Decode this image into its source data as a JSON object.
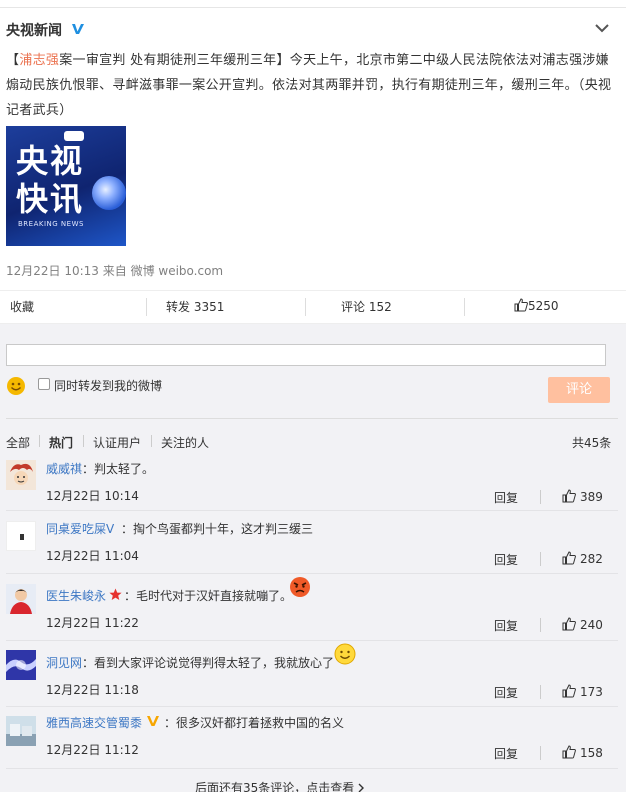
{
  "post": {
    "author": "央视新闻",
    "text_highlight": "浦志强",
    "text_topic": "案一审宣判 处有期徒刑三年缓刑三年",
    "text_body": "今天上午，北京市第二中级人民法院依法对浦志强涉嫌煽动民族仇恨罪、寻衅滋事罪一案公开宣判。依法对其两罪并罚，执行有期徒刑三年，缓刑三年。（央视记者武兵）",
    "bracket_open": "【",
    "bracket_close": "】",
    "thumb_line1": "央视",
    "thumb_line2": "快讯",
    "thumb_sub": "BREAKING NEWS",
    "timestamp": "12月22日 10:13",
    "source": "来自 微博 weibo.com"
  },
  "actions": {
    "favorite": "收藏",
    "repost": "转发 3351",
    "comment": "评论 152",
    "like": "5250"
  },
  "compose": {
    "input_value": "",
    "repost_label": "同时转发到我的微博",
    "submit_label": "评论"
  },
  "filters": {
    "all": "全部",
    "hot": "热门",
    "verified": "认证用户",
    "following": "关注的人",
    "total": "共45条"
  },
  "comments": [
    {
      "name": "威威祺",
      "text": "：判太轻了。",
      "time": "12月22日 10:14",
      "reply": "回复",
      "likes": "389"
    },
    {
      "name": "同桌爱吃屎V",
      "text": "：掏个鸟蛋都判十年，这才判三缓三",
      "time": "12月22日 11:04",
      "reply": "回复",
      "likes": "282"
    },
    {
      "name": "医生朱峻永",
      "text": "：毛时代对于汉奸直接就嘣了。",
      "time": "12月22日 11:22",
      "reply": "回复",
      "likes": "240"
    },
    {
      "name": "洞见网",
      "text": "：看到大家评论说觉得判得太轻了，我就放心了",
      "time": "12月22日 11:18",
      "reply": "回复",
      "likes": "173"
    },
    {
      "name": "雅西高速交管蜀黍",
      "text": "：很多汉奸都打着拯救中国的名义",
      "time": "12月22日 11:12",
      "reply": "回复",
      "likes": "158"
    }
  ],
  "more_label": "后面还有35条评论，点击查看",
  "colors": {
    "accent": "#eb7350",
    "link_blue": "#3e78c4",
    "vip_gold": "#f7a600",
    "submit_disabled": "#ffc09f"
  }
}
